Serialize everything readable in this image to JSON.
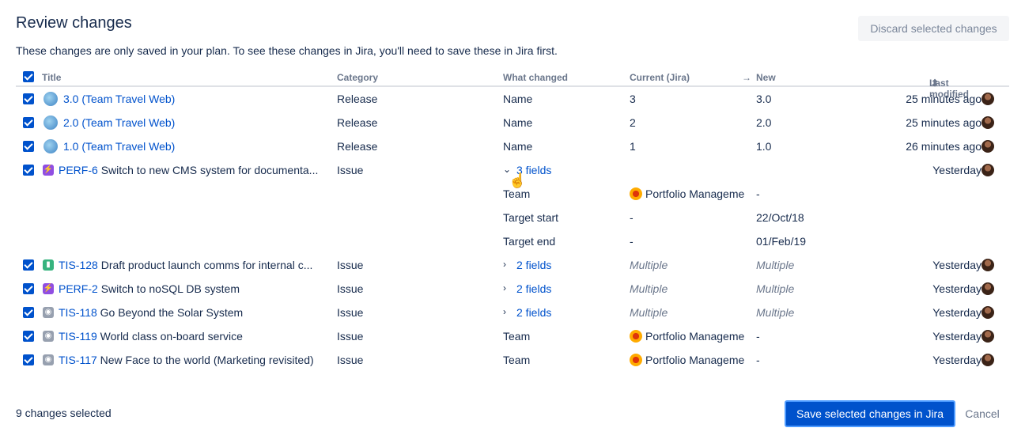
{
  "dialog": {
    "title": "Review changes",
    "discard_label": "Discard selected changes",
    "description": "These changes are only saved in your plan. To see these changes in Jira, you'll need to save these in Jira first."
  },
  "table": {
    "headers": {
      "title": "Title",
      "category": "Category",
      "what_changed": "What changed",
      "current": "Current (Jira)",
      "new": "New",
      "last_modified": "Last modified"
    },
    "rows": [
      {
        "key": "",
        "title": "3.0 (Team Travel Web)",
        "category": "Release",
        "what": "Name",
        "current": "3",
        "new": "3.0",
        "modified": "25 minutes ago"
      },
      {
        "key": "",
        "title": "2.0 (Team Travel Web)",
        "category": "Release",
        "what": "Name",
        "current": "2",
        "new": "2.0",
        "modified": "25 minutes ago"
      },
      {
        "key": "",
        "title": "1.0 (Team Travel Web)",
        "category": "Release",
        "what": "Name",
        "current": "1",
        "new": "1.0",
        "modified": "26 minutes ago"
      },
      {
        "key": "PERF-6",
        "title": "Switch to new CMS system for documenta...",
        "category": "Issue",
        "what": "3 fields",
        "current": "",
        "new": "",
        "modified": "Yesterday"
      },
      {
        "key": "TIS-128",
        "title": "Draft product launch comms for internal c...",
        "category": "Issue",
        "what": "2 fields",
        "current": "Multiple",
        "new": "Multiple",
        "modified": "Yesterday"
      },
      {
        "key": "PERF-2",
        "title": "Switch to noSQL DB system",
        "category": "Issue",
        "what": "2 fields",
        "current": "Multiple",
        "new": "Multiple",
        "modified": "Yesterday"
      },
      {
        "key": "TIS-118",
        "title": "Go Beyond the Solar System",
        "category": "Issue",
        "what": "2 fields",
        "current": "Multiple",
        "new": "Multiple",
        "modified": "Yesterday"
      },
      {
        "key": "TIS-119",
        "title": "World class on-board service",
        "category": "Issue",
        "what": "Team",
        "current": "Portfolio Manageme",
        "new": "-",
        "modified": "Yesterday"
      },
      {
        "key": "TIS-117",
        "title": "New Face to the world (Marketing revisited)",
        "category": "Issue",
        "what": "Team",
        "current": "Portfolio Manageme",
        "new": "-",
        "modified": "Yesterday"
      }
    ],
    "expanded": [
      {
        "field": "Team",
        "current": "Portfolio Manageme",
        "new": "-"
      },
      {
        "field": "Target start",
        "current": "-",
        "new": "22/Oct/18"
      },
      {
        "field": "Target end",
        "current": "-",
        "new": "01/Feb/19"
      }
    ]
  },
  "footer": {
    "count_label": "9 changes selected",
    "save_label": "Save selected changes in Jira",
    "cancel_label": "Cancel"
  },
  "colors": {
    "primary": "#0052CC",
    "text": "#172B4D",
    "subtle": "#6B778C"
  }
}
